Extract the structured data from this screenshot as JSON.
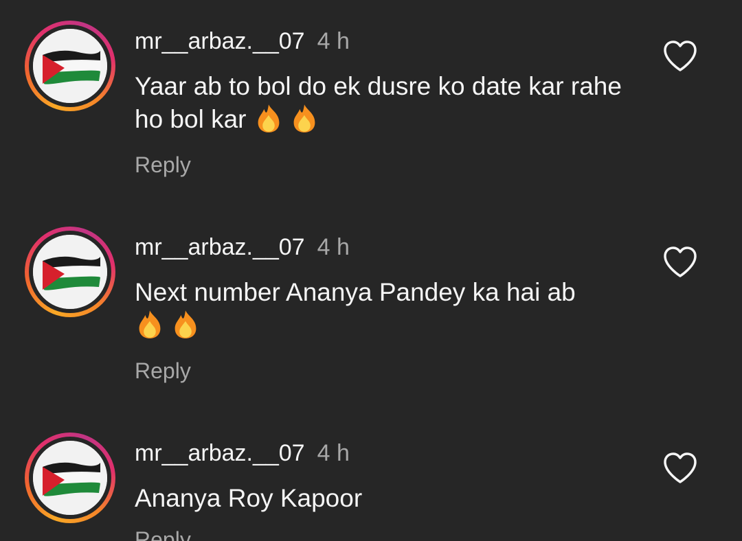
{
  "colors": {
    "background": "#262626",
    "text_primary": "#f5f5f5",
    "text_secondary": "#a8a8a8",
    "story_ring": [
      "#f9a826",
      "#e1306c",
      "#c13584"
    ]
  },
  "comments": [
    {
      "username": "mr__arbaz.__07",
      "time": "4 h",
      "text": "Yaar ab to bol do ek dusre ko date kar rahe ho bol kar",
      "emoji_count": 2,
      "reply_label": "Reply",
      "avatar_icon": "palestine-flag-icon",
      "like_icon": "heart-outline-icon"
    },
    {
      "username": "mr__arbaz.__07",
      "time": "4 h",
      "text": "Next number Ananya Pandey ka hai ab",
      "emoji_count": 2,
      "reply_label": "Reply",
      "avatar_icon": "palestine-flag-icon",
      "like_icon": "heart-outline-icon"
    },
    {
      "username": "mr__arbaz.__07",
      "time": "4 h",
      "text": "Ananya Roy Kapoor",
      "emoji_count": 0,
      "reply_label": "Reply",
      "avatar_icon": "palestine-flag-icon",
      "like_icon": "heart-outline-icon"
    }
  ]
}
